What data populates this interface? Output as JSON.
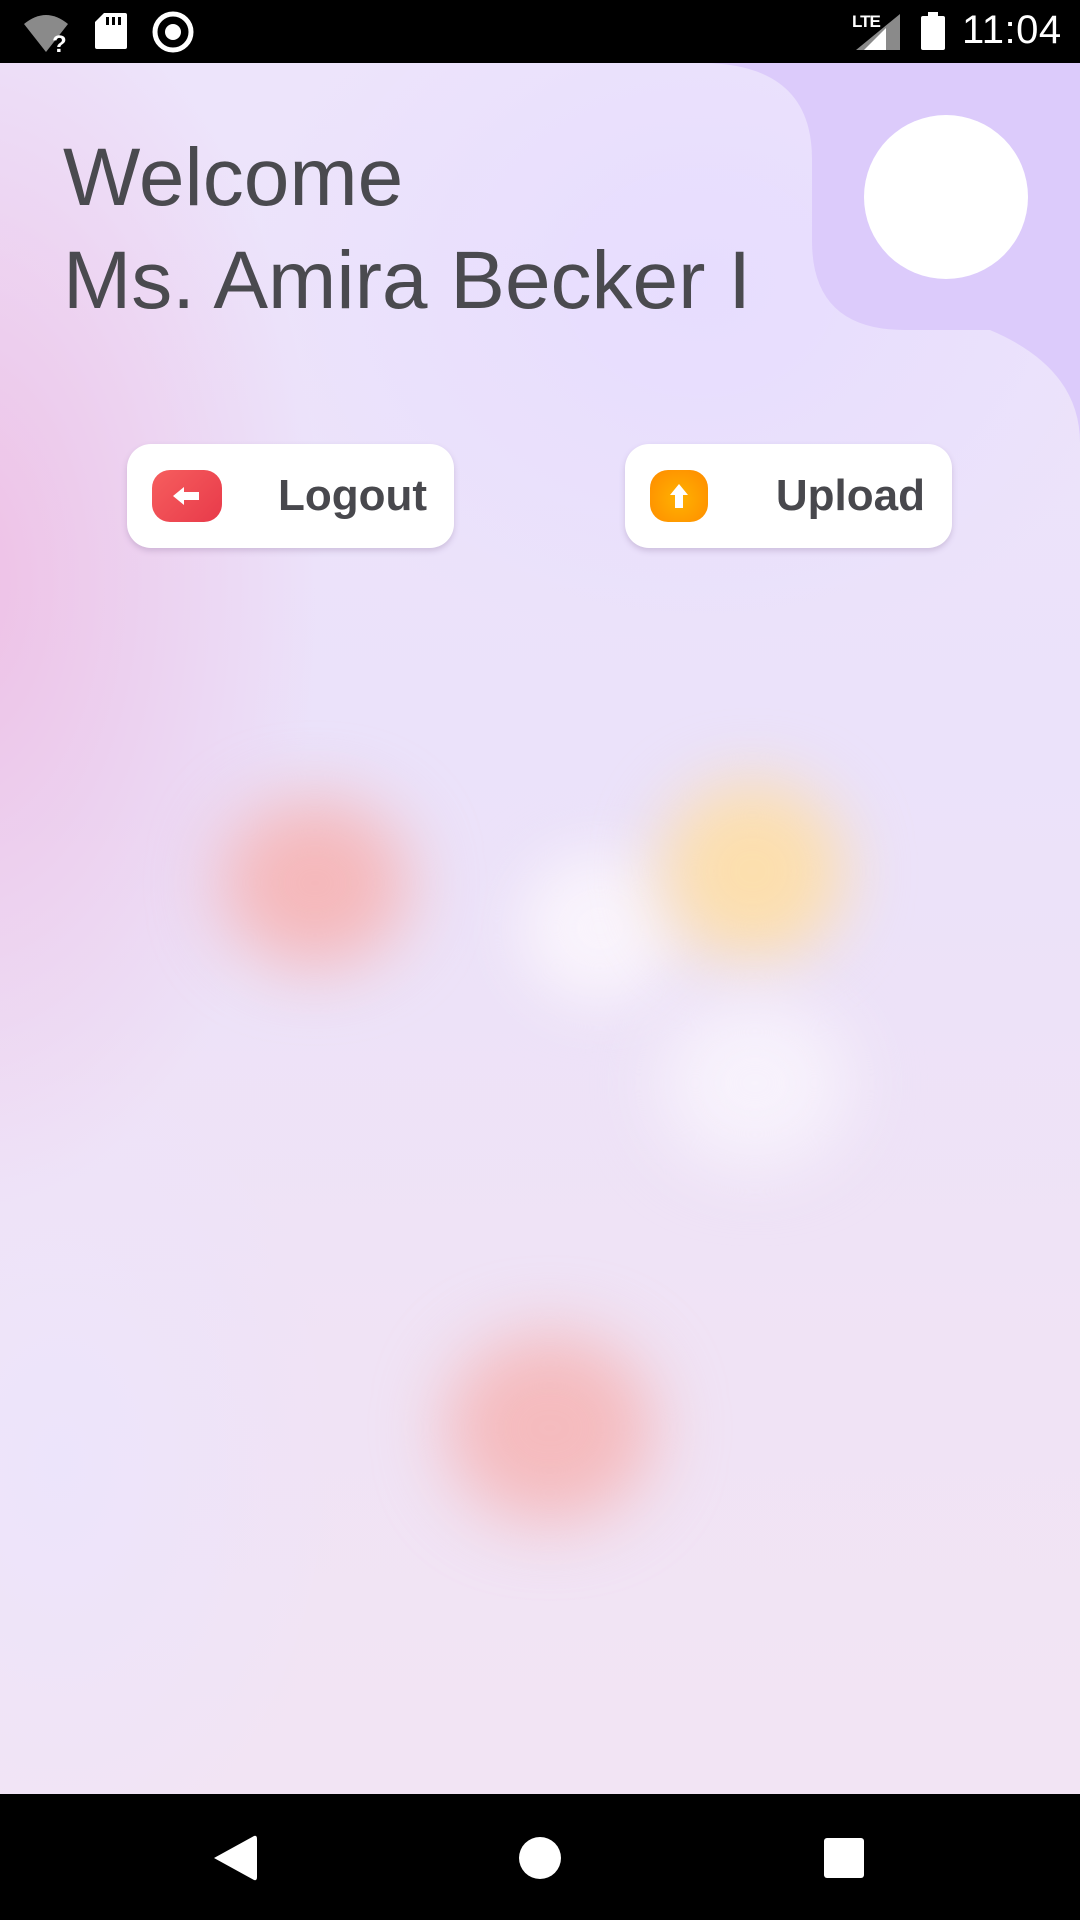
{
  "status_bar": {
    "time": "11:04",
    "network": "LTE",
    "icons": [
      "wifi-unknown-icon",
      "sd-card-icon",
      "record-icon",
      "lte-signal-icon",
      "battery-icon"
    ]
  },
  "home": {
    "welcome_label": "Welcome",
    "user_name": "Ms. Amira Becker I"
  },
  "actions": {
    "logout": {
      "label": "Logout",
      "icon": "arrow-left-icon",
      "color": "#F04A52"
    },
    "upload": {
      "label": "Upload",
      "icon": "arrow-up-icon",
      "color": "#FF9800"
    }
  },
  "nav_bar": {
    "icons": [
      "back-icon",
      "home-icon",
      "recents-icon"
    ]
  },
  "colors": {
    "text": "#4A4A4F",
    "accent_panel": "#DCCBFB",
    "background": "#EEE4F8"
  }
}
